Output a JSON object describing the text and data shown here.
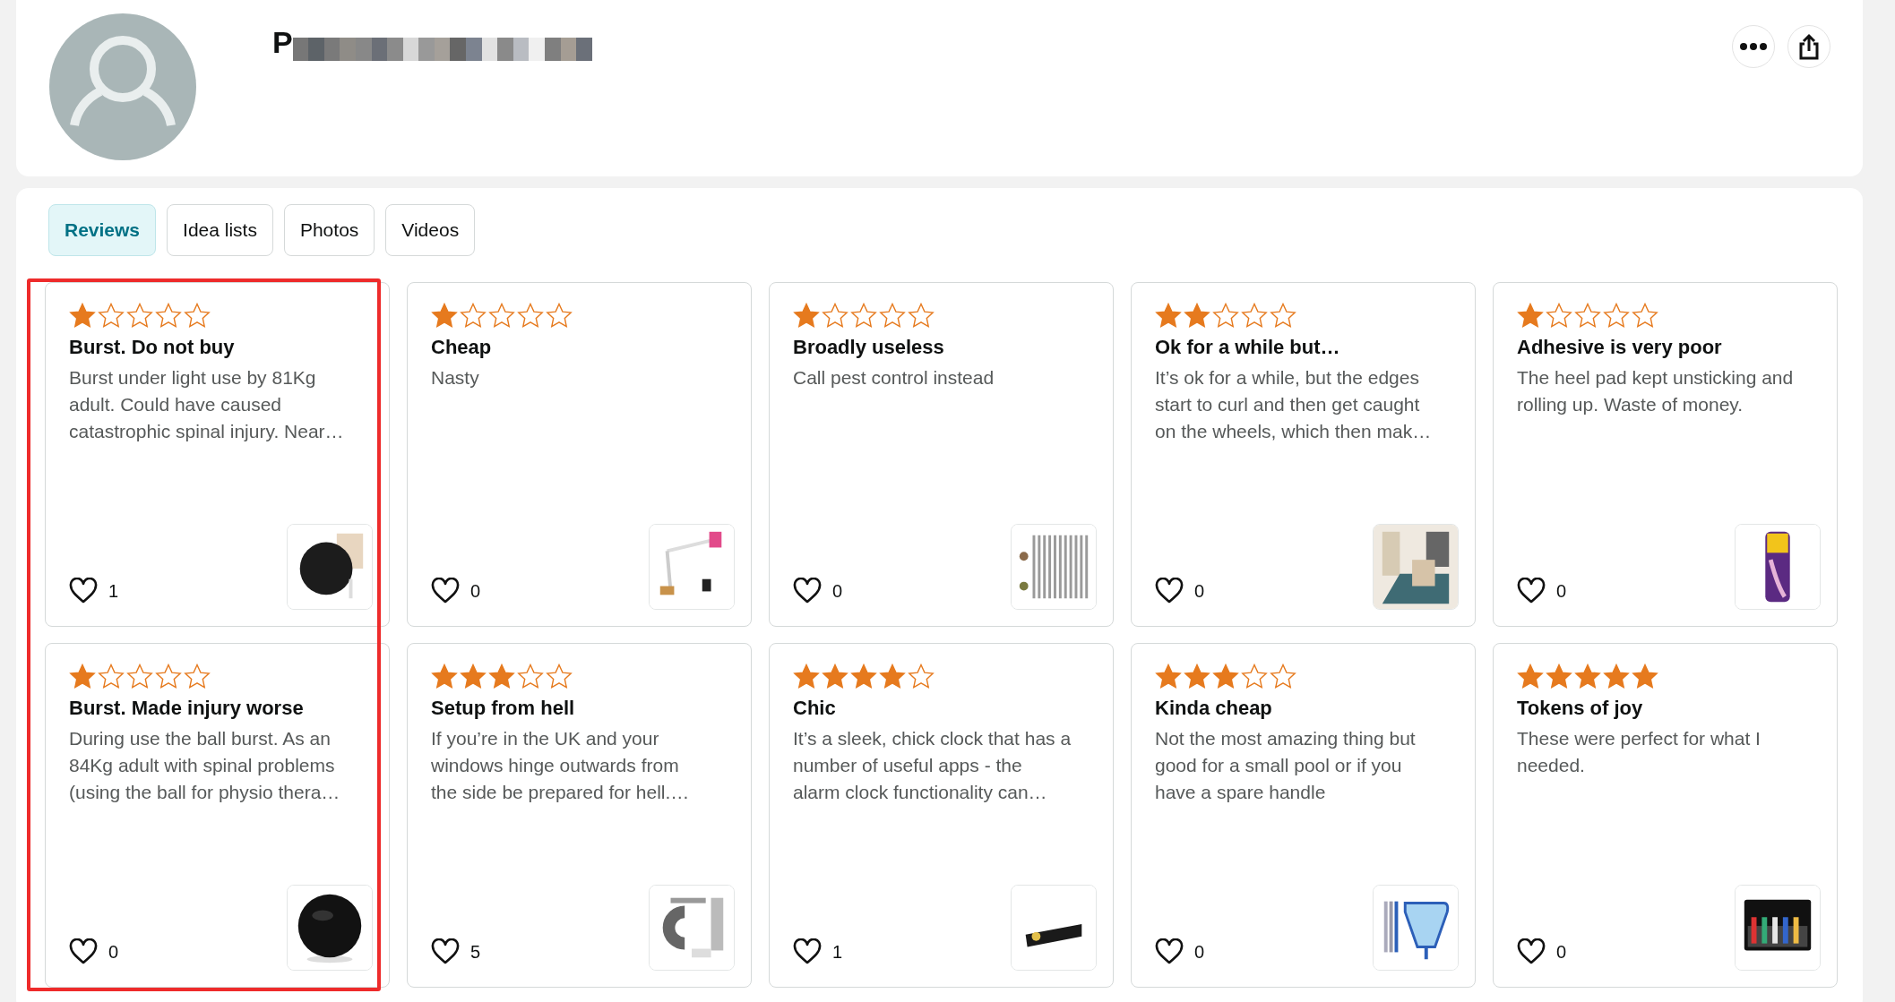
{
  "profile": {
    "name": "P",
    "redacted": true
  },
  "tabs": [
    {
      "label": "Reviews",
      "selected": true
    },
    {
      "label": "Idea lists",
      "selected": false
    },
    {
      "label": "Photos",
      "selected": false
    },
    {
      "label": "Videos",
      "selected": false
    }
  ],
  "reviews": [
    {
      "stars": 1,
      "title": "Burst. Do not buy",
      "body": "Burst under light use by 81Kg adult. Could have caused catastrophic spinal injury. Near…",
      "likes": "1",
      "highlighted": true
    },
    {
      "stars": 1,
      "title": "Cheap",
      "body": "Nasty",
      "likes": "0",
      "highlighted": false
    },
    {
      "stars": 1,
      "title": "Broadly useless",
      "body": "Call pest control instead",
      "likes": "0",
      "highlighted": false
    },
    {
      "stars": 2,
      "title": "Ok for a while but…",
      "body": "It’s ok for a while, but the edges start to curl and then get caught on the wheels, which then mak…",
      "likes": "0",
      "highlighted": false
    },
    {
      "stars": 1,
      "title": "Adhesive is very poor",
      "body": "The heel pad kept unsticking and rolling up. Waste of money.",
      "likes": "0",
      "highlighted": false
    },
    {
      "stars": 1,
      "title": "Burst. Made injury worse",
      "body": "During use the ball burst. As an 84Kg adult with spinal problems (using the ball for physio thera…",
      "likes": "0",
      "highlighted": true
    },
    {
      "stars": 3,
      "title": "Setup from hell",
      "body": "If you’re in the UK and your windows hinge outwards from the side be prepared for hell.…",
      "likes": "5",
      "highlighted": false
    },
    {
      "stars": 4,
      "title": "Chic",
      "body": "It’s a sleek, chick clock that has a number of useful apps - the alarm clock functionality can…",
      "likes": "1",
      "highlighted": false
    },
    {
      "stars": 3,
      "title": "Kinda cheap",
      "body": "Not the most amazing thing but good for a small pool or if you have a spare handle",
      "likes": "0",
      "highlighted": false
    },
    {
      "stars": 5,
      "title": "Tokens of joy",
      "body": "These were perfect for what I needed.",
      "likes": "0",
      "highlighted": false
    }
  ]
}
